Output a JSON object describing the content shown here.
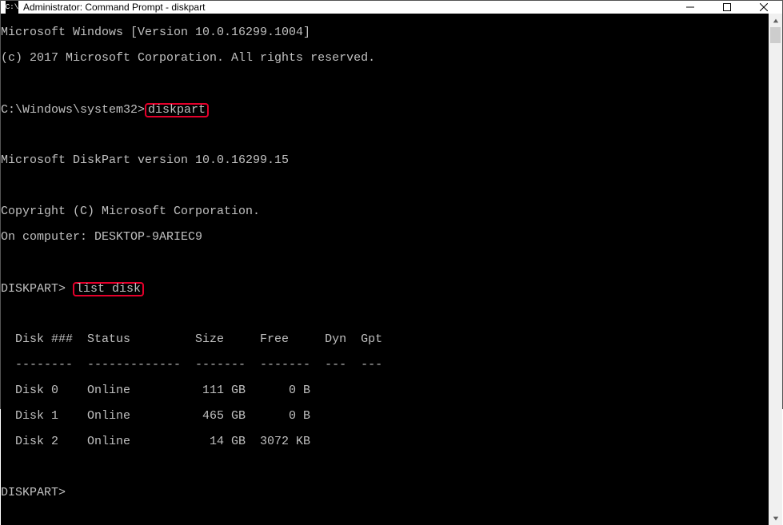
{
  "titlebar": {
    "icon_text": "C:\\",
    "title": "Administrator: Command Prompt - diskpart"
  },
  "terminal": {
    "lines": {
      "l1": "Microsoft Windows [Version 10.0.16299.1004]",
      "l2": "(c) 2017 Microsoft Corporation. All rights reserved.",
      "l3": "",
      "prompt1_prefix": "C:\\Windows\\system32>",
      "prompt1_cmd": "diskpart",
      "l5": "",
      "l6": "Microsoft DiskPart version 10.0.16299.15",
      "l7": "",
      "l8": "Copyright (C) Microsoft Corporation.",
      "l9": "On computer: DESKTOP-9ARIEC9",
      "l10": "",
      "prompt2_prefix": "DISKPART> ",
      "prompt2_cmd": "list disk",
      "l12": "",
      "header": "  Disk ###  Status         Size     Free     Dyn  Gpt",
      "divider": "  --------  -------------  -------  -------  ---  ---",
      "row0": "  Disk 0    Online          111 GB      0 B",
      "row1": "  Disk 1    Online          465 GB      0 B",
      "row2": "  Disk 2    Online           14 GB  3072 KB",
      "l18": "",
      "prompt3": "DISKPART> "
    },
    "disks": [
      {
        "id": "Disk 0",
        "status": "Online",
        "size": "111 GB",
        "free": "0 B",
        "dyn": "",
        "gpt": ""
      },
      {
        "id": "Disk 1",
        "status": "Online",
        "size": "465 GB",
        "free": "0 B",
        "dyn": "",
        "gpt": ""
      },
      {
        "id": "Disk 2",
        "status": "Online",
        "size": "14 GB",
        "free": "3072 KB",
        "dyn": "",
        "gpt": ""
      }
    ]
  }
}
